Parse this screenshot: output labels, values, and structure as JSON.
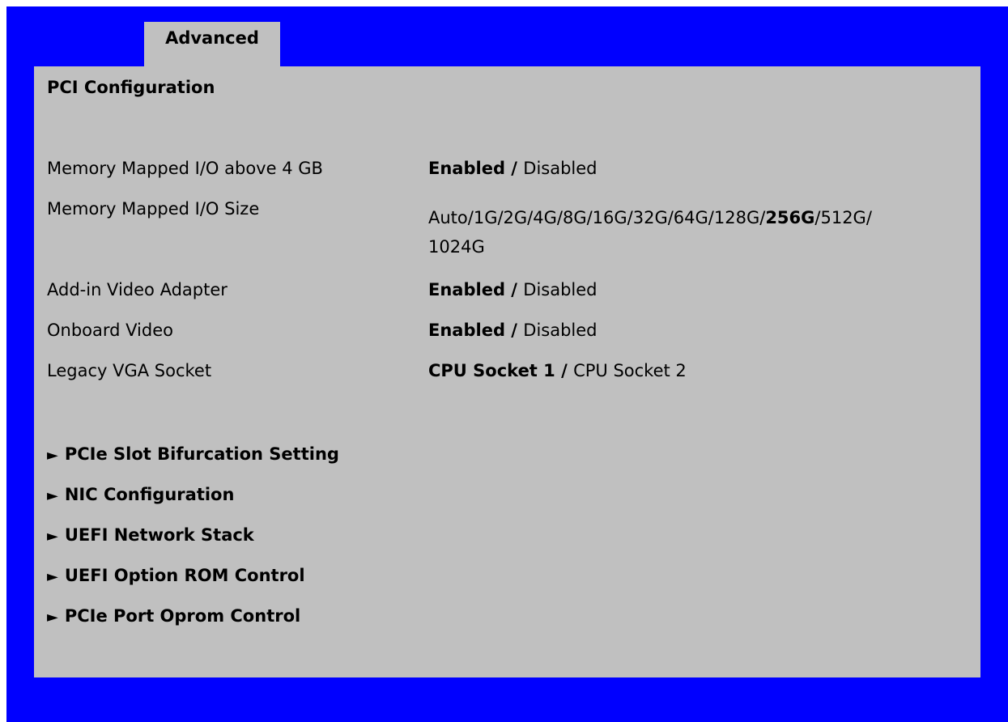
{
  "tab": {
    "label": "Advanced"
  },
  "page": {
    "title": "PCI Configuration"
  },
  "settings": [
    {
      "label": "Memory Mapped I/O above 4 GB",
      "options": [
        {
          "text": "Enabled",
          "bold": true
        },
        {
          "text": " / ",
          "bold": true
        },
        {
          "text": "Disabled",
          "bold": false
        }
      ]
    },
    {
      "label": "Memory Mapped I/O Size",
      "options": [
        {
          "text": "Auto/1G/2G/4G/8G/16G/32G/64G/128G/",
          "bold": false
        },
        {
          "text": "256G",
          "bold": true
        },
        {
          "text": "/512G/",
          "bold": false
        }
      ],
      "line2": "1024G"
    },
    {
      "label": "Add-in Video Adapter",
      "options": [
        {
          "text": "Enabled",
          "bold": true
        },
        {
          "text": " / ",
          "bold": true
        },
        {
          "text": "Disabled",
          "bold": false
        }
      ]
    },
    {
      "label": "Onboard Video",
      "options": [
        {
          "text": "Enabled",
          "bold": true
        },
        {
          "text": " / ",
          "bold": true
        },
        {
          "text": "Disabled",
          "bold": false
        }
      ]
    },
    {
      "label": "Legacy VGA Socket",
      "options": [
        {
          "text": "CPU Socket 1",
          "bold": true
        },
        {
          "text": " / ",
          "bold": true
        },
        {
          "text": "CPU Socket 2",
          "bold": false
        }
      ]
    }
  ],
  "submenus": [
    {
      "arrow": "►",
      "label": "PCIe Slot Bifurcation Setting"
    },
    {
      "arrow": "►",
      "label": "NIC Configuration"
    },
    {
      "arrow": "►",
      "label": "UEFI Network Stack"
    },
    {
      "arrow": "►",
      "label": "UEFI Option ROM Control"
    },
    {
      "arrow": "►",
      "label": "PCIe Port Oprom Control"
    }
  ],
  "colors": {
    "background": "#0000ff",
    "panel": "#c0c0c0"
  }
}
